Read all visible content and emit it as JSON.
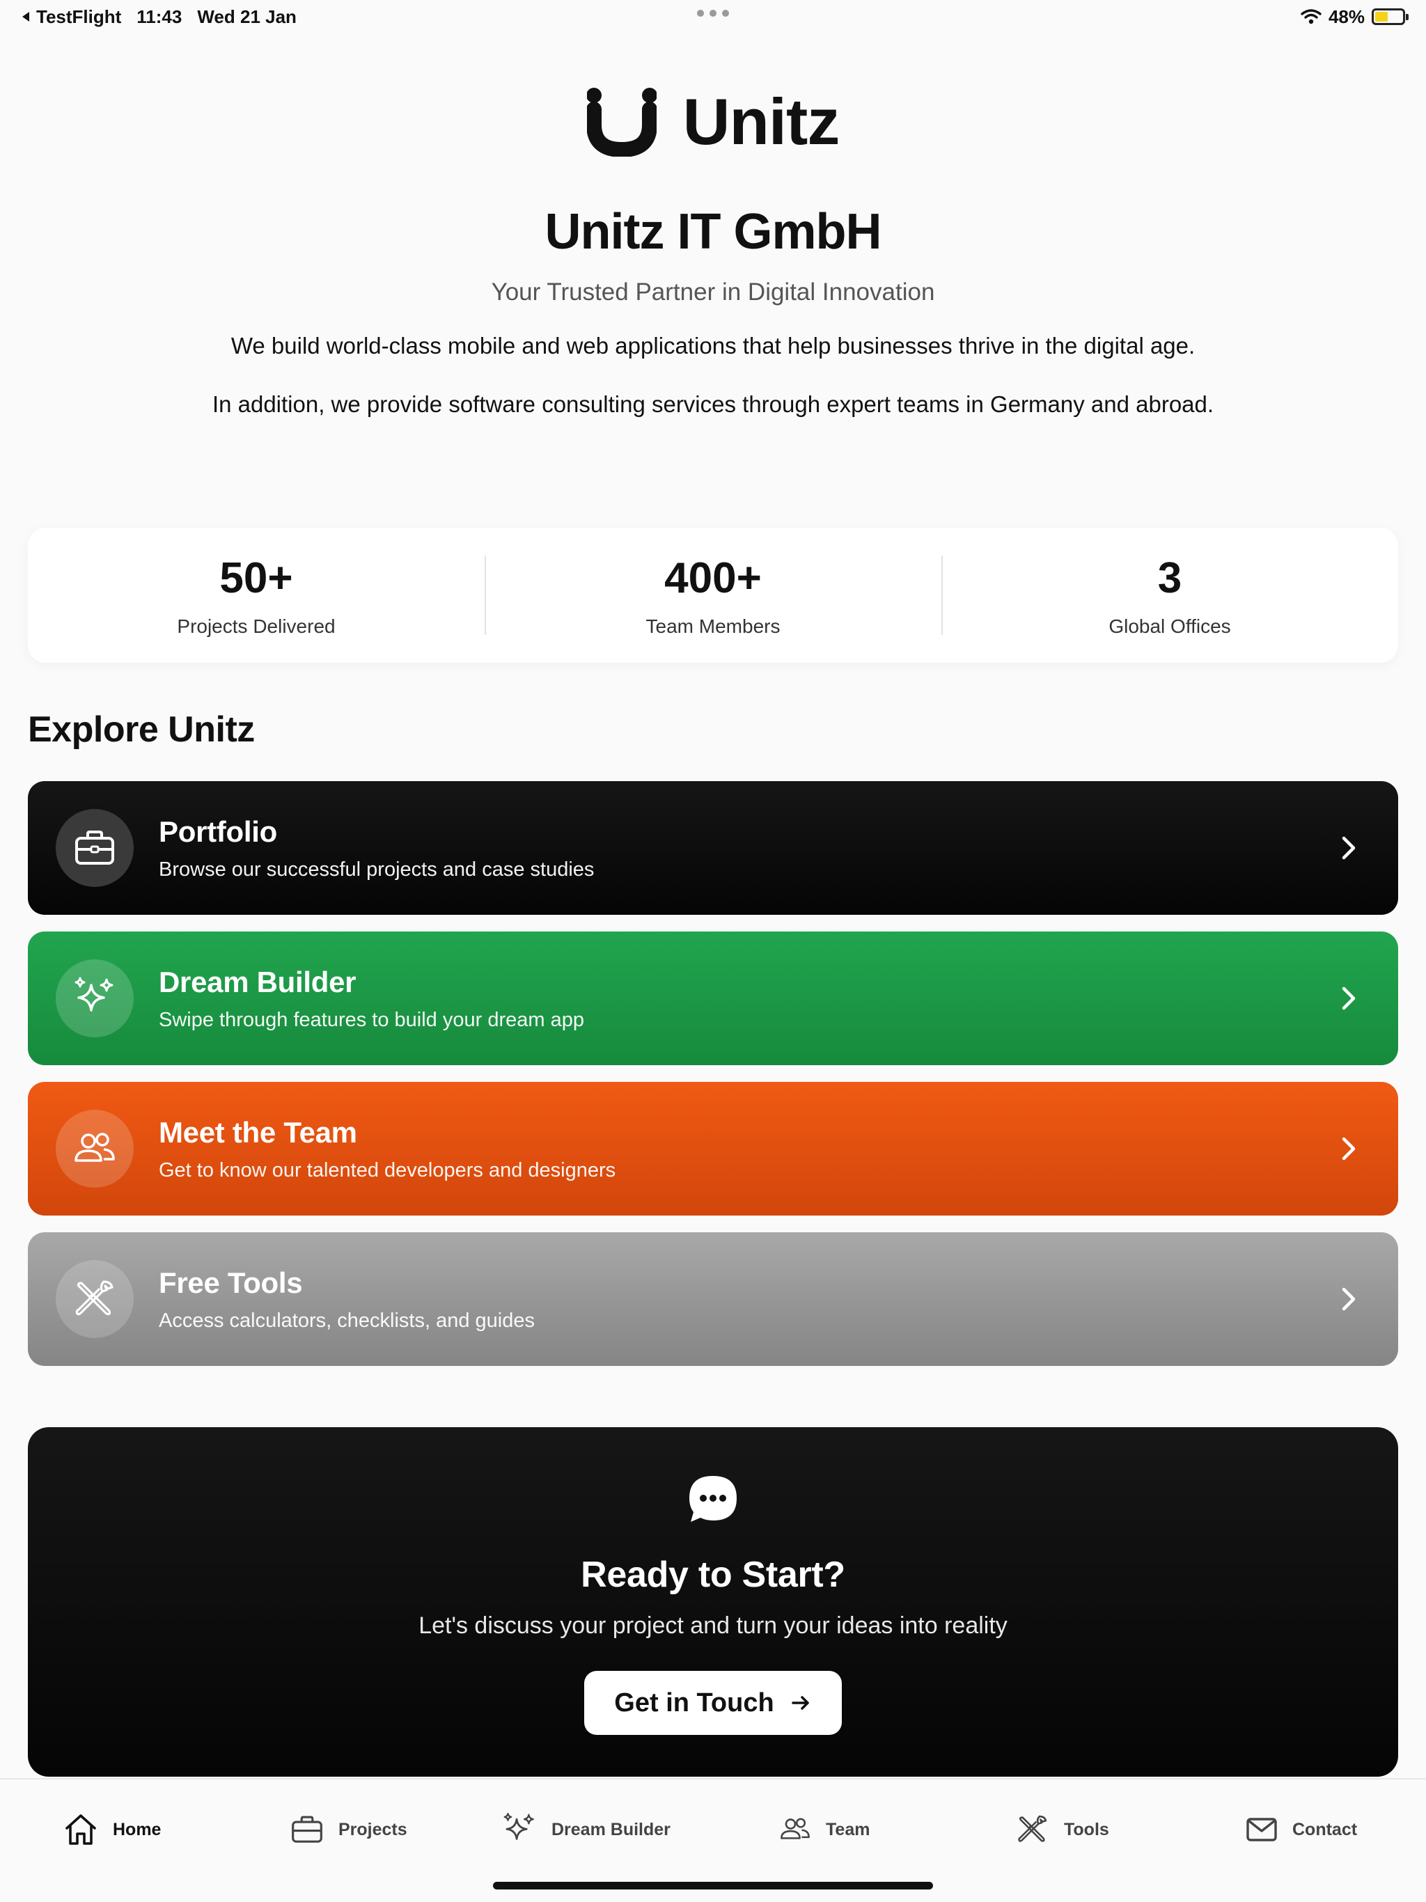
{
  "status_bar": {
    "back_app": "TestFlight",
    "time": "11:43",
    "date": "Wed 21 Jan",
    "battery": "48%",
    "battery_level": 0.48
  },
  "hero": {
    "logo_text": "Unitz",
    "company_name": "Unitz IT GmbH",
    "tagline": "Your Trusted Partner in Digital Innovation",
    "description_1": "We build world-class mobile and web applications that help businesses thrive in the digital age.",
    "description_2": "In addition, we provide software consulting services through expert teams in Germany and abroad."
  },
  "stats": [
    {
      "value": "50+",
      "label": "Projects Delivered"
    },
    {
      "value": "400+",
      "label": "Team Members"
    },
    {
      "value": "3",
      "label": "Global Offices"
    }
  ],
  "explore": {
    "title": "Explore Unitz",
    "cards": [
      {
        "title": "Portfolio",
        "subtitle": "Browse our successful projects and case studies",
        "icon": "briefcase-icon",
        "color": "#0a0a0a"
      },
      {
        "title": "Dream Builder",
        "subtitle": "Swipe through features to build your dream app",
        "icon": "sparkles-icon",
        "color": "#1e9c49"
      },
      {
        "title": "Meet the Team",
        "subtitle": "Get to know our talented developers and designers",
        "icon": "users-icon",
        "color": "#e8520f"
      },
      {
        "title": "Free Tools",
        "subtitle": "Access calculators, checklists, and guides",
        "icon": "tools-icon",
        "color": "#969696"
      }
    ]
  },
  "cta": {
    "title": "Ready to Start?",
    "subtitle": "Let's discuss your project and turn your ideas into reality",
    "button_label": "Get in Touch",
    "icon": "chat-bubble-icon"
  },
  "tab_bar": {
    "active": "Home",
    "tabs": [
      {
        "label": "Home",
        "icon": "home-icon"
      },
      {
        "label": "Projects",
        "icon": "briefcase-icon"
      },
      {
        "label": "Dream Builder",
        "icon": "sparkles-icon"
      },
      {
        "label": "Team",
        "icon": "users-icon"
      },
      {
        "label": "Tools",
        "icon": "tools-icon"
      },
      {
        "label": "Contact",
        "icon": "mail-icon"
      }
    ]
  }
}
